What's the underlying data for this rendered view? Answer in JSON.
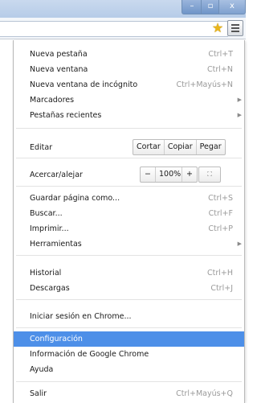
{
  "titlebar": {
    "min_icon": "minimize-icon",
    "max_icon": "maximize-icon",
    "close_label": "x",
    "min_label": "–",
    "max_label": "▫"
  },
  "toolbar": {
    "bookmark_icon": "star-icon",
    "menu_icon": "hamburger-menu-icon"
  },
  "menu": {
    "new_tab": {
      "label": "Nueva pestaña",
      "shortcut": "Ctrl+T"
    },
    "new_window": {
      "label": "Nueva ventana",
      "shortcut": "Ctrl+N"
    },
    "incognito": {
      "label": "Nueva ventana de incógnito",
      "shortcut": "Ctrl+Mayús+N"
    },
    "bookmarks": {
      "label": "Marcadores"
    },
    "recent_tabs": {
      "label": "Pestañas recientes"
    },
    "edit": {
      "label": "Editar",
      "cut": "Cortar",
      "copy": "Copiar",
      "paste": "Pegar"
    },
    "zoom": {
      "label": "Acercar/alejar",
      "minus": "−",
      "value": "100%",
      "plus": "+",
      "fullscreen_icon": "fullscreen-icon"
    },
    "save_page": {
      "label": "Guardar página como...",
      "shortcut": "Ctrl+S"
    },
    "find": {
      "label": "Buscar...",
      "shortcut": "Ctrl+F"
    },
    "print": {
      "label": "Imprimir...",
      "shortcut": "Ctrl+P"
    },
    "tools": {
      "label": "Herramientas"
    },
    "history": {
      "label": "Historial",
      "shortcut": "Ctrl+H"
    },
    "downloads": {
      "label": "Descargas",
      "shortcut": "Ctrl+J"
    },
    "signin": {
      "label": "Iniciar sesión en Chrome..."
    },
    "settings": {
      "label": "Configuración"
    },
    "about": {
      "label": "Información de Google Chrome"
    },
    "help": {
      "label": "Ayuda"
    },
    "exit": {
      "label": "Salir",
      "shortcut": "Ctrl+Mayús+Q"
    }
  },
  "colors": {
    "highlight": "#4d8fe8",
    "titlebar": "#c9d9ee",
    "shortcut_text": "#9a9a9a"
  }
}
